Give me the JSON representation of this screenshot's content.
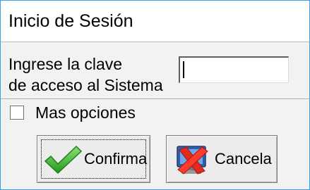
{
  "window": {
    "title": "Inicio de Sesión"
  },
  "login": {
    "prompt_line1": "Ingrese la clave",
    "prompt_line2": "de acceso al Sistema",
    "password_value": ""
  },
  "options": {
    "more_label": "Mas opciones",
    "more_checked": false
  },
  "buttons": {
    "confirm_label": "Confirma",
    "confirm_icon": "checkmark-icon",
    "cancel_label": "Cancela",
    "cancel_icon": "cancel-monitor-icon"
  },
  "colors": {
    "frame_border": "#3aa0e6",
    "check_green": "#3dbb34",
    "cancel_red": "#e02b20"
  }
}
